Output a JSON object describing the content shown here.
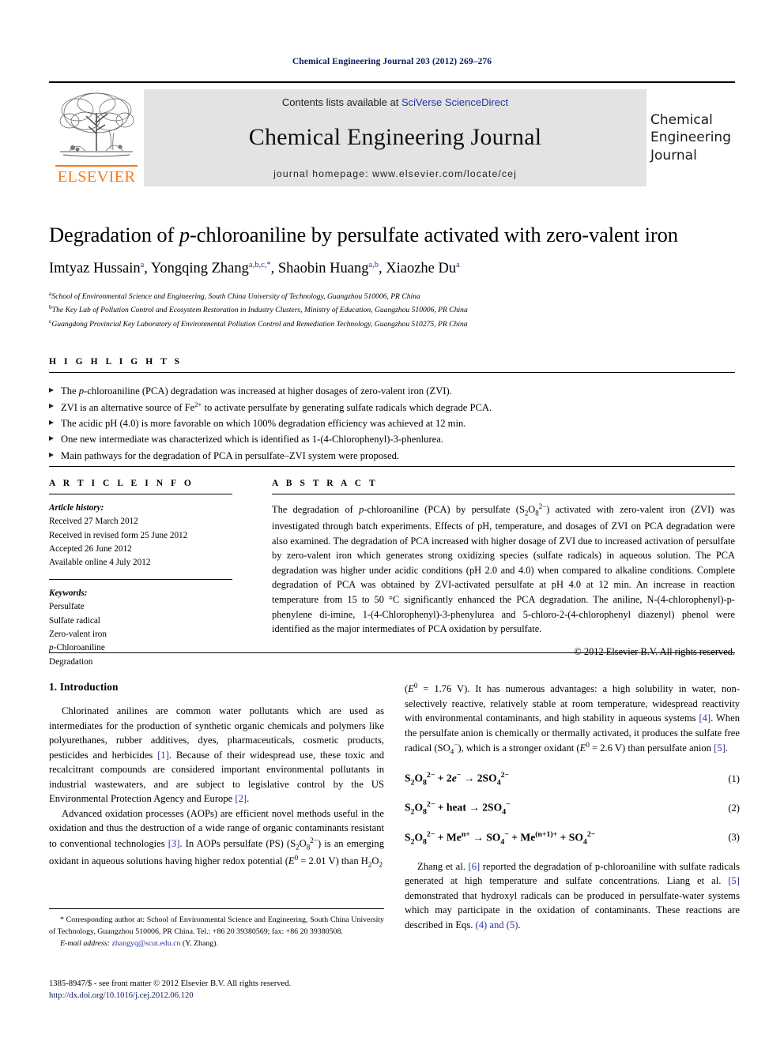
{
  "running_head": "Chemical Engineering Journal 203 (2012) 269–276",
  "masthead": {
    "publisher_name": "ELSEVIER",
    "contents_prefix": "Contents lists available at ",
    "sciencedirect_link": "SciVerse ScienceDirect",
    "journal_title": "Chemical Engineering Journal",
    "homepage": "journal homepage: www.elsevier.com/locate/cej",
    "cover_line1": "Chemical",
    "cover_line2": "Engineering",
    "cover_line3": "Journal"
  },
  "article": {
    "title_part1": "Degradation of ",
    "title_italic": "p",
    "title_part2": "-chloroaniline by persulfate activated with zero-valent iron",
    "authors": [
      {
        "name": "Imtyaz Hussain",
        "sup": "a"
      },
      {
        "name": "Yongqing Zhang",
        "sup": "a,b,c,*"
      },
      {
        "name": "Shaobin Huang",
        "sup": "a,b"
      },
      {
        "name": "Xiaozhe Du",
        "sup": "a"
      }
    ],
    "affiliations": [
      {
        "label": "a",
        "text": "School of Environmental Science and Engineering, South China University of Technology, Guangzhou 510006, PR China"
      },
      {
        "label": "b",
        "text": "The Key Lab of Pollution Control and Ecosystem Restoration in Industry Clusters, Ministry of Education, Guangzhou 510006, PR China"
      },
      {
        "label": "c",
        "text": "Guangdong Provincial Key Laboratory of Environmental Pollution Control and Remediation Technology, Guangzhou 510275, PR China"
      }
    ]
  },
  "highlights": {
    "heading": "H I G H L I G H T S",
    "items": [
      "The p-chloroaniline (PCA) degradation was increased at higher dosages of zero-valent iron (ZVI).",
      "ZVI is an alternative source of Fe2+ to activate persulfate by generating sulfate radicals which degrade PCA.",
      "The acidic pH (4.0) is more favorable on which 100% degradation efficiency was achieved at 12 min.",
      "One new intermediate was characterized which is identified as 1-(4-Chlorophenyl)-3-phenlurea.",
      "Main pathways for the degradation of PCA in persulfate–ZVI system were proposed."
    ]
  },
  "article_info": {
    "heading": "A R T I C L E    I N F O",
    "history_label": "Article history:",
    "history": [
      "Received 27 March 2012",
      "Received in revised form 25 June 2012",
      "Accepted 26 June 2012",
      "Available online 4 July 2012"
    ],
    "keywords_label": "Keywords:",
    "keywords": [
      "Persulfate",
      "Sulfate radical",
      "Zero-valent iron",
      "p-Chloroaniline",
      "Degradation"
    ]
  },
  "abstract": {
    "heading": "A B S T R A C T",
    "text": "The degradation of p-chloroaniline (PCA) by persulfate (S2O8 2-) activated with zero-valent iron (ZVI) was investigated through batch experiments. Effects of pH, temperature, and dosages of ZVI on PCA degradation were also examined. The degradation of PCA increased with higher dosage of ZVI due to increased activation of persulfate by zero-valent iron which generates strong oxidizing species (sulfate radicals) in aqueous solution. The PCA degradation was higher under acidic conditions (pH 2.0 and 4.0) when compared to alkaline conditions. Complete degradation of PCA was obtained by ZVI-activated persulfate at pH 4.0 at 12 min. An increase in reaction temperature from 15 to 50 °C significantly enhanced the PCA degradation. The aniline, N-(4-chlorophenyl)-p-phenylene di-imine, 1-(4-Chlorophenyl)-3-phenylurea and 5-chloro-2-(4-chlorophenyl diazenyl) phenol were identified as the major intermediates of PCA oxidation by persulfate.",
    "copyright": "© 2012 Elsevier B.V. All rights reserved."
  },
  "introduction": {
    "heading": "1. Introduction",
    "para1": "Chlorinated anilines are common water pollutants which are used as intermediates for the production of synthetic organic chemicals and polymers like polyurethanes, rubber additives, dyes, pharmaceuticals, cosmetic products, pesticides and herbicides [1]. Because of their widespread use, these toxic and recalcitrant compounds are considered important environmental pollutants in industrial wastewaters, and are subject to legislative control by the US Environmental Protection Agency and Europe [2].",
    "para2": "Advanced oxidation processes (AOPs) are efficient novel methods useful in the oxidation and thus the destruction of a wide range of organic contaminants resistant to conventional technologies [3]. In AOPs persulfate (PS) (S2O8 2-) is an emerging oxidant in aqueous solutions having higher redox potential (E0 = 2.01 V) than H2O2",
    "para3": "(E0 = 1.76 V). It has numerous advantages: a high solubility in water, non-selectively reactive, relatively stable at room temperature, widespread reactivity with environmental contaminants, and high stability in aqueous systems [4]. When the persulfate anion is chemically or thermally activated, it produces the sulfate free radical (SO4 -), which is a stronger oxidant (E0 = 2.6 V) than persulfate anion [5].",
    "para4": "Zhang et al. [6] reported the degradation of p-chloroaniline with sulfate radicals generated at high temperature and sulfate concentrations. Liang et al. [5] demonstrated that hydroxyl radicals can be produced in persulfate-water systems which may participate in the oxidation of contaminants. These reactions are described in Eqs. (4) and (5)."
  },
  "equations": [
    {
      "number": "(1)",
      "text": "S2O8 2- + 2e- → 2SO4 2-"
    },
    {
      "number": "(2)",
      "text": "S2O8 2- + heat → 2SO4 -"
    },
    {
      "number": "(3)",
      "text": "S2O8 2- + Men+ → SO4 - + Me(n+1)+ + SO4 2-"
    }
  ],
  "footnote": {
    "corresponding": "* Corresponding author at: School of Environmental Science and Engineering, South China University of Technology, Guangzhou 510006, PR China. Tel.: +86 20 39380569; fax: +86 20 39380508.",
    "email_label": "E-mail address:",
    "email": "zhangyq@scut.edu.cn",
    "email_owner": "(Y. Zhang).",
    "issn_line": "1385-8947/$ - see front matter © 2012 Elsevier B.V. All rights reserved.",
    "doi": "http://dx.doi.org/10.1016/j.cej.2012.06.120"
  },
  "colors": {
    "link_blue": "#2b35a0",
    "elsevier_orange": "#f47c20",
    "masthead_gray": "#e3e3e3",
    "running_head_navy": "#111a5c"
  }
}
